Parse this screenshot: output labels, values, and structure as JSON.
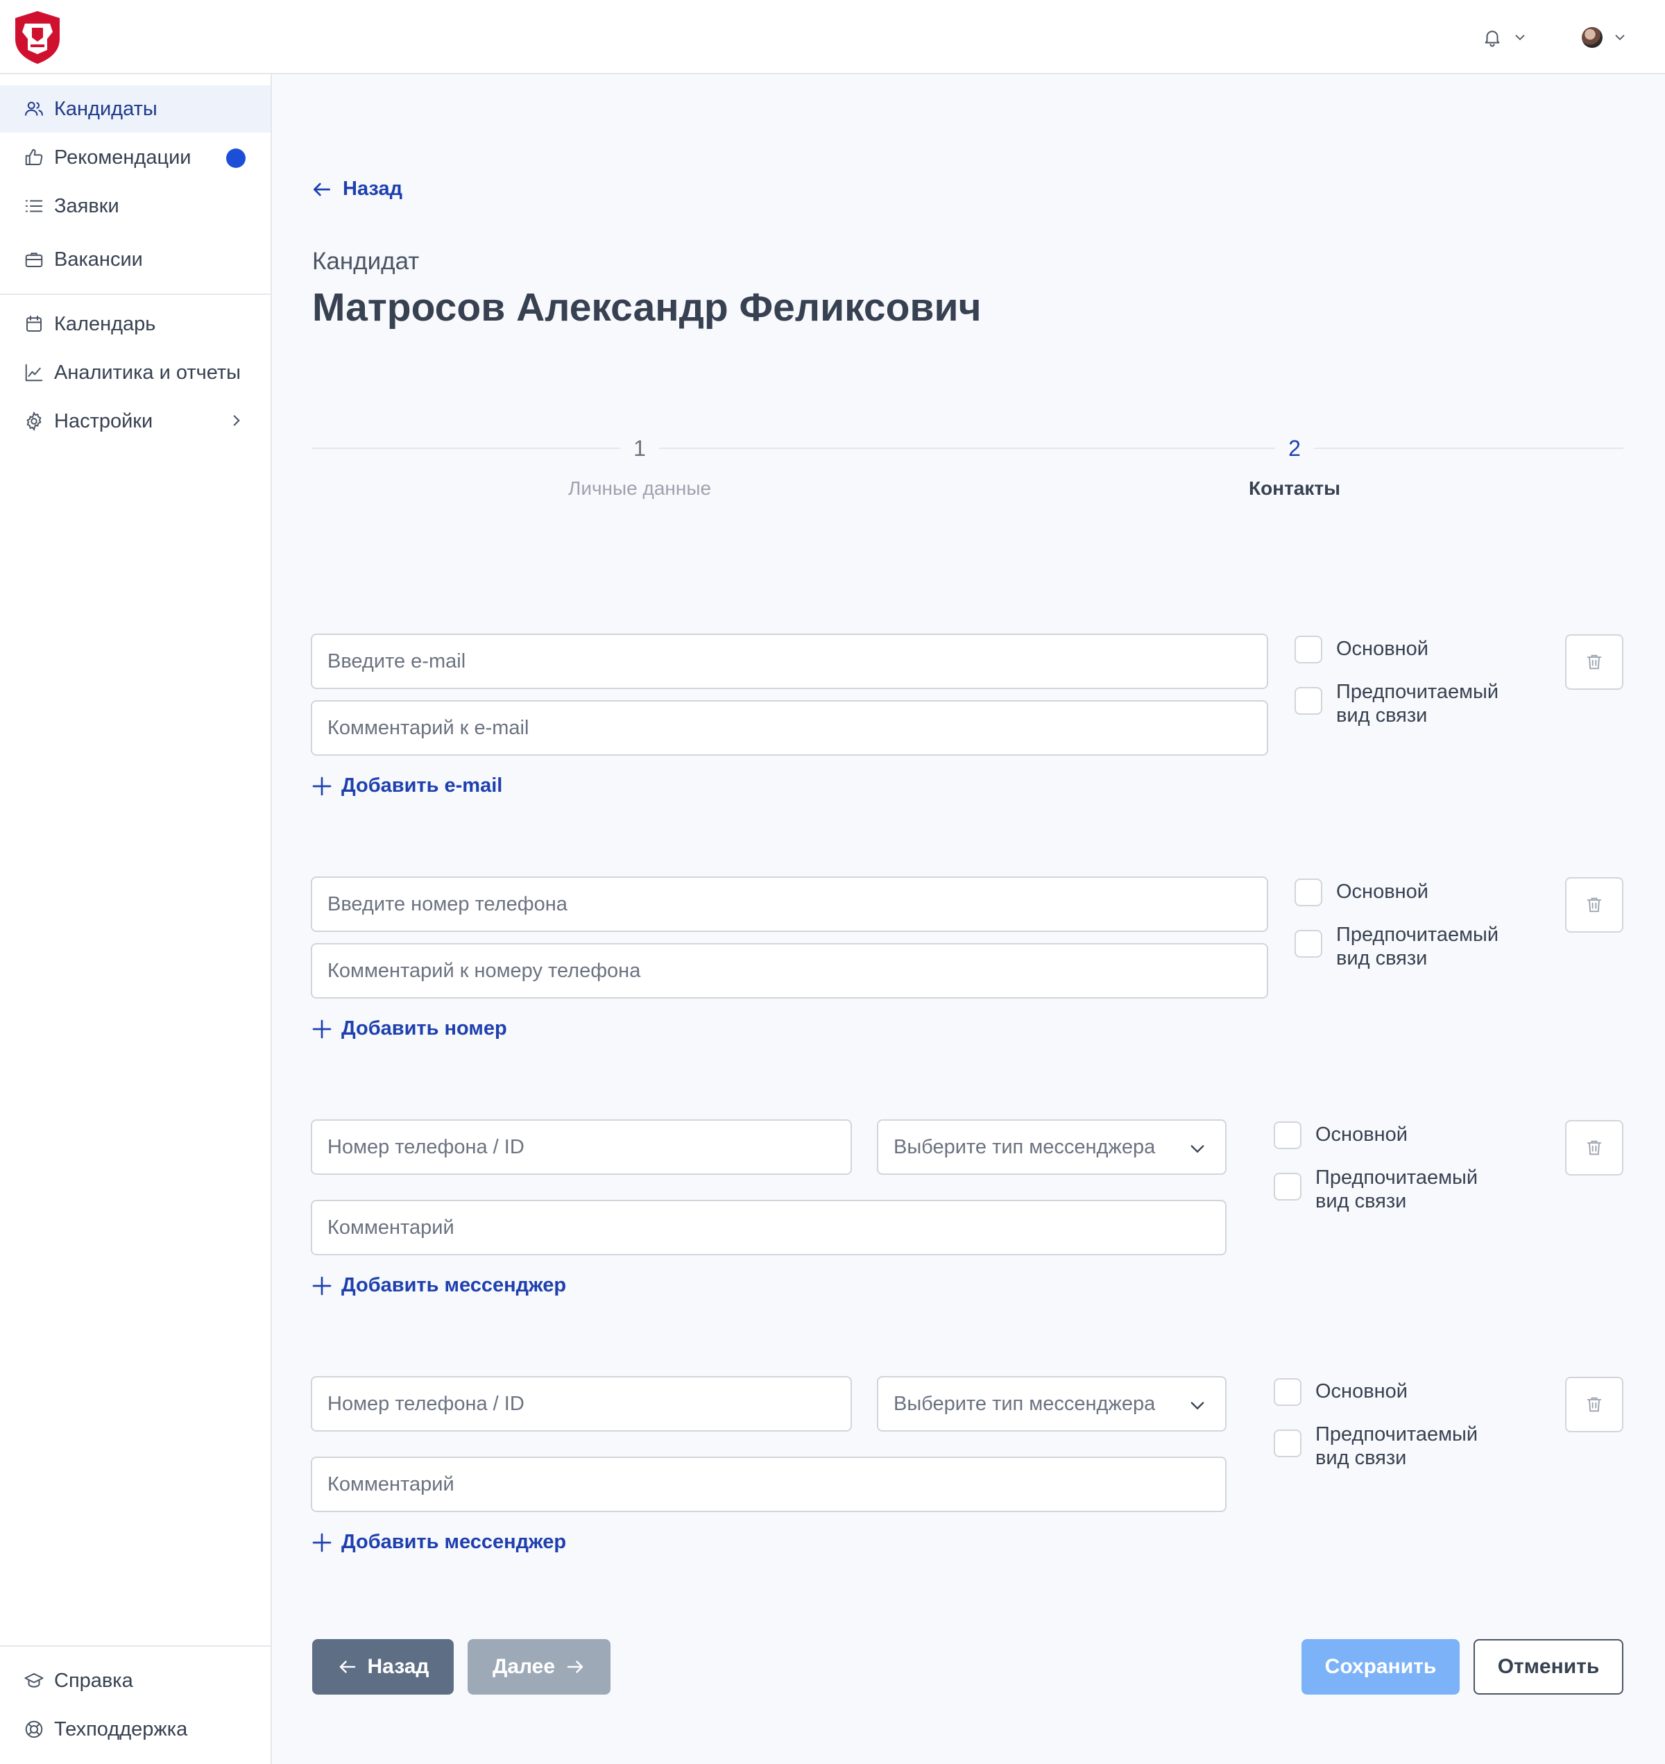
{
  "header": {
    "notifications_icon": "bell-icon",
    "user_icon": "avatar",
    "colors": {
      "logo": "#d0102f",
      "accent": "#1e40af"
    }
  },
  "sidebar": {
    "items": [
      {
        "label": "Кандидаты",
        "icon": "users-icon",
        "active": true
      },
      {
        "label": "Рекомендации",
        "icon": "thumbs-up-icon",
        "badge": "dot"
      },
      {
        "label": "Заявки",
        "icon": "list-icon"
      },
      {
        "label": "Вакансии",
        "icon": "briefcase-icon"
      },
      {
        "label": "Календарь",
        "icon": "calendar-icon"
      },
      {
        "label": "Аналитика и отчеты",
        "icon": "chart-icon"
      },
      {
        "label": "Настройки",
        "icon": "gear-icon",
        "has_submenu": true
      }
    ],
    "bottom": [
      {
        "label": "Справка",
        "icon": "graduation-icon"
      },
      {
        "label": "Техподдержка",
        "icon": "lifebuoy-icon"
      }
    ]
  },
  "page": {
    "back_label": "Назад",
    "subtitle": "Кандидат",
    "title": "Матросов Александр Феликсович"
  },
  "stepper": {
    "steps": [
      {
        "number": "1",
        "label": "Личные данные",
        "active": false
      },
      {
        "number": "2",
        "label": "Контакты",
        "active": true
      }
    ]
  },
  "contacts": {
    "email": {
      "value_placeholder": "Введите e-mail",
      "comment_placeholder": "Комментарий к e-mail",
      "primary_label": "Основной",
      "preferred_label_1": "Предпочитаемый",
      "preferred_label_2": "вид связи",
      "add_label": "Добавить e-mail"
    },
    "phone": {
      "value_placeholder": "Введите номер телефона",
      "comment_placeholder": "Комментарий к номеру телефона",
      "primary_label": "Основной",
      "preferred_label_1": "Предпочитаемый",
      "preferred_label_2": "вид связи",
      "add_label": "Добавить номер"
    },
    "messengers": [
      {
        "id_placeholder": "Номер телефона / ID",
        "type_placeholder": "Выберите тип мессенджера",
        "comment_placeholder": "Комментарий",
        "primary_label": "Основной",
        "preferred_label_1": "Предпочитаемый",
        "preferred_label_2": "вид связи",
        "add_label": "Добавить мессенджер"
      },
      {
        "id_placeholder": "Номер телефона / ID",
        "type_placeholder": "Выберите тип мессенджера",
        "comment_placeholder": "Комментарий",
        "primary_label": "Основной",
        "preferred_label_1": "Предпочитаемый",
        "preferred_label_2": "вид связи",
        "add_label": "Добавить мессенджер"
      }
    ]
  },
  "footer": {
    "back_label": "Назад",
    "next_label": "Далее",
    "save_label": "Сохранить",
    "cancel_label": "Отменить"
  }
}
